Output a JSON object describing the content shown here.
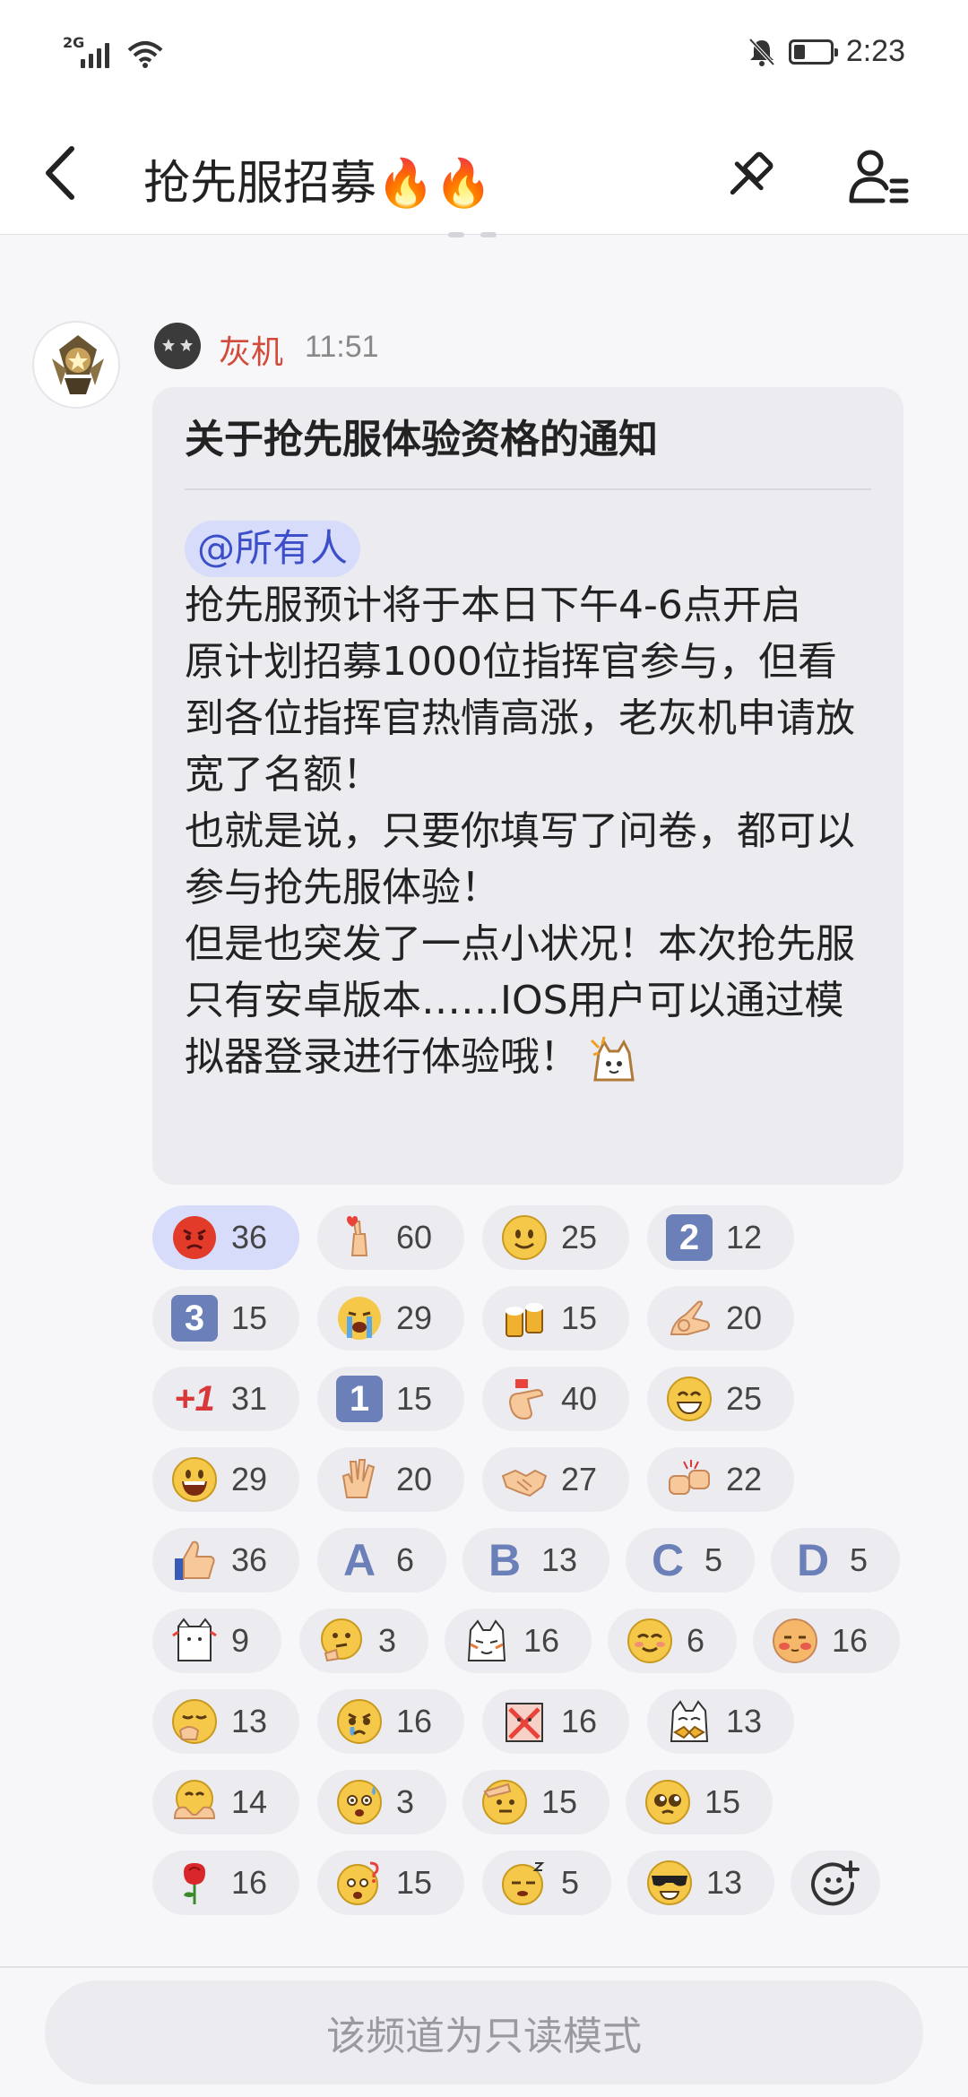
{
  "status_bar": {
    "network": "2G",
    "time": "2:23"
  },
  "header": {
    "title": "抢先服招募🔥🔥"
  },
  "message": {
    "sender": "灰机",
    "time": "11:51",
    "title": "关于抢先服体验资格的通知",
    "mention": "@所有人",
    "lines": [
      "抢先服预计将于本日下午4-6点开启",
      "原计划招募1000位指挥官参与，但看到各位指挥官热情高涨，老灰机申请放宽了名额！",
      "也就是说，只要你填写了问卷，都可以参与抢先服体验！",
      "但是也突发了一点小状况！本次抢先服只有安卓版本……IOS用户可以通过模拟器登录进行体验哦！"
    ]
  },
  "reactions": [
    {
      "icon": "angry-face",
      "glyph": "😡",
      "count": "36",
      "active": true
    },
    {
      "icon": "finger-heart",
      "glyph": "🫰",
      "count": "60"
    },
    {
      "icon": "smile-face",
      "glyph": "🙂",
      "count": "25"
    },
    {
      "icon": "square-2",
      "label": "2",
      "count": "12"
    },
    {
      "icon": "square-3",
      "label": "3",
      "count": "15"
    },
    {
      "icon": "crying-face",
      "glyph": "😭",
      "count": "29"
    },
    {
      "icon": "cheers-mugs",
      "glyph": "🍻",
      "count": "15"
    },
    {
      "icon": "ok-hand",
      "glyph": "👌",
      "count": "20"
    },
    {
      "icon": "plus-one",
      "label": "+1",
      "count": "31"
    },
    {
      "icon": "square-1",
      "label": "1",
      "count": "15"
    },
    {
      "icon": "666-hand",
      "glyph": "🤙",
      "count": "40"
    },
    {
      "icon": "grin-face",
      "glyph": "😁",
      "count": "25"
    },
    {
      "icon": "big-smile",
      "glyph": "😀",
      "count": "29"
    },
    {
      "icon": "clapping-hands",
      "glyph": "👏",
      "count": "20"
    },
    {
      "icon": "handshake",
      "glyph": "🤝",
      "count": "27"
    },
    {
      "icon": "fist-bump",
      "glyph": "🤜",
      "count": "22"
    },
    {
      "icon": "thumbs-up",
      "glyph": "👍",
      "count": "36"
    },
    {
      "icon": "letter-a",
      "label": "A",
      "count": "6"
    },
    {
      "icon": "letter-b",
      "label": "B",
      "count": "13"
    },
    {
      "icon": "letter-c",
      "label": "C",
      "count": "5"
    },
    {
      "icon": "letter-d",
      "label": "D",
      "count": "5"
    },
    {
      "icon": "cat-cheer",
      "glyph": "🐱",
      "count": "9"
    },
    {
      "icon": "thinking-face",
      "glyph": "🤔",
      "count": "3"
    },
    {
      "icon": "cat-face",
      "glyph": "😺",
      "count": "16"
    },
    {
      "icon": "blush-face",
      "glyph": "😊",
      "count": "6"
    },
    {
      "icon": "shy-face",
      "glyph": "🥰",
      "count": "16"
    },
    {
      "icon": "yawn-face",
      "glyph": "🥱",
      "count": "13"
    },
    {
      "icon": "teary-face",
      "glyph": "🥲",
      "count": "16"
    },
    {
      "icon": "cat-cross",
      "glyph": "🙅",
      "count": "16"
    },
    {
      "icon": "cat-bow",
      "glyph": "🙆",
      "count": "13"
    },
    {
      "icon": "hug-face",
      "glyph": "🤗",
      "count": "14"
    },
    {
      "icon": "sweat-face",
      "glyph": "😰",
      "count": "3"
    },
    {
      "icon": "salute-face",
      "glyph": "🫡",
      "count": "15"
    },
    {
      "icon": "pleading-face",
      "glyph": "🥺",
      "count": "15"
    },
    {
      "icon": "rose",
      "glyph": "🌹",
      "count": "16"
    },
    {
      "icon": "question-face",
      "glyph": "😲",
      "count": "15"
    },
    {
      "icon": "sleepy-face",
      "glyph": "😪",
      "count": "5"
    },
    {
      "icon": "sunglasses-face",
      "glyph": "😎",
      "count": "13"
    }
  ],
  "footer": {
    "readonly_text": "该频道为只读模式"
  }
}
